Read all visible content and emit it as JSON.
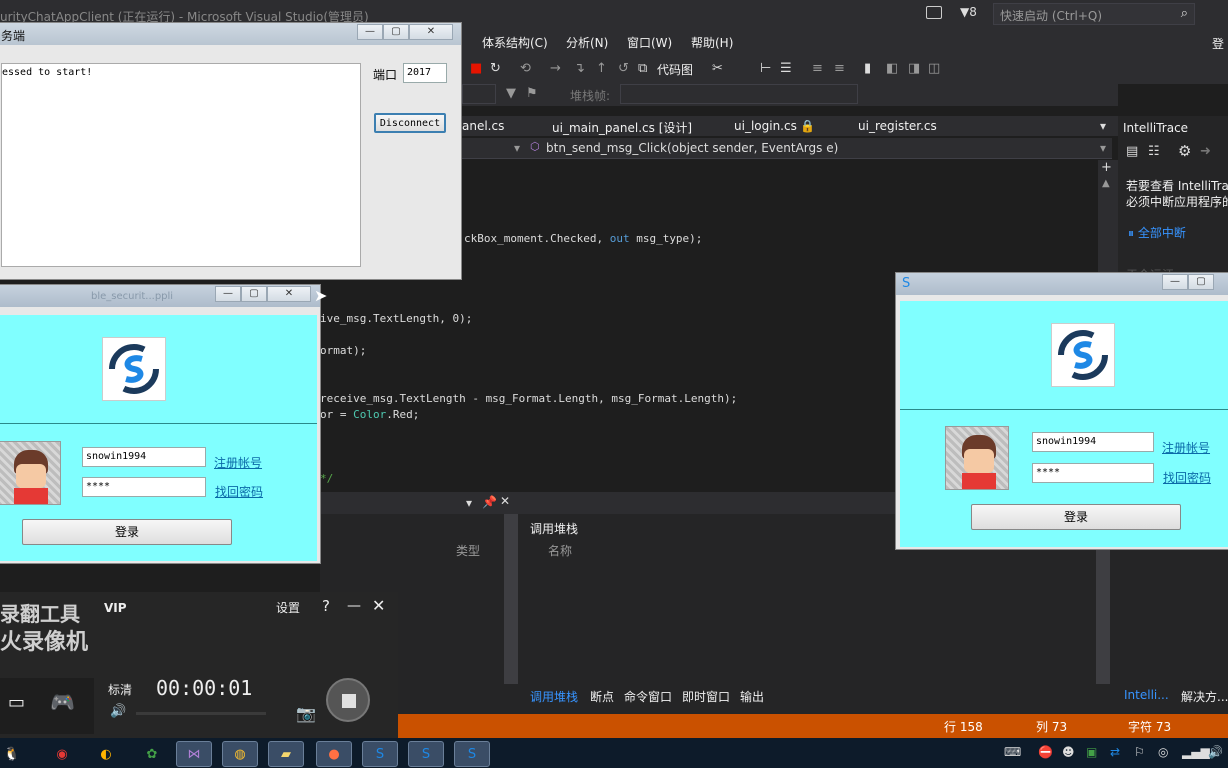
{
  "vs": {
    "title": "urityChatAppClient (正在运行) - Microsoft Visual Studio(管理员)",
    "notif_count": "8",
    "quick_launch": "快速启动 (Ctrl+Q)",
    "login_corner": "登",
    "menu": [
      "体系结构(C)",
      "分析(N)",
      "窗口(W)",
      "帮助(H)"
    ],
    "code_map": "代码图",
    "stack_frame_label": "堆栈帧:",
    "tabs": [
      "anel.cs",
      "ui_main_panel.cs [设计]",
      "ui_login.cs",
      "ui_register.cs"
    ],
    "nav_method": "btn_send_msg_Click(object sender, EventArgs e)",
    "code": {
      "l1_a": "ckBox_moment.Checked, ",
      "l1_b": "out",
      "l1_c": " msg_type);",
      "l2": "ive_msg.TextLength, 0);",
      "l3": "ormat);",
      "l4": "receive_msg.TextLength - msg_Format.Length, msg_Format.Length);",
      "l5_a": "or = ",
      "l5_b": "Color",
      "l5_c": ".Red;",
      "l6": "*/"
    },
    "intellitrace": {
      "title": "IntelliTrace",
      "text1": "若要查看 IntelliTra",
      "text2": "必须中断应用程序的",
      "link": "全部中断",
      "faded": "于全运汗"
    },
    "bottom": {
      "type_col": "类型",
      "callstack_title": "调用堆栈",
      "name_col": "名称",
      "tabs": [
        "调用堆栈",
        "断点",
        "命令窗口",
        "即时窗口",
        "输出"
      ],
      "right_tabs": [
        "Intelli...",
        "解决方..."
      ]
    },
    "status": {
      "line": "行 158",
      "col": "列 73",
      "char": "字符 73"
    }
  },
  "server_win": {
    "title": "务端",
    "log": "essed to start!",
    "port_label": "端口",
    "port_value": "2017",
    "disconnect": "Disconnect"
  },
  "login_left": {
    "bg_caption": "ble_securit...ppli",
    "username": "snowin1994",
    "password": "****",
    "register": "注册帐号",
    "recover": "找回密码",
    "login": "登录"
  },
  "login_right": {
    "username": "snowin1994",
    "password": "****",
    "register": "注册帐号",
    "recover": "找回密码",
    "login": "登录"
  },
  "recorder": {
    "brand1": "录翻工具",
    "brand2": "火录像机",
    "vip": "VIP",
    "settings": "设置",
    "help": "?",
    "quality": "标清",
    "time": "00:00:01"
  },
  "colors": {
    "accent": "#ca5100",
    "dialog_bg": "#80ffff",
    "link": "#3794ff"
  }
}
